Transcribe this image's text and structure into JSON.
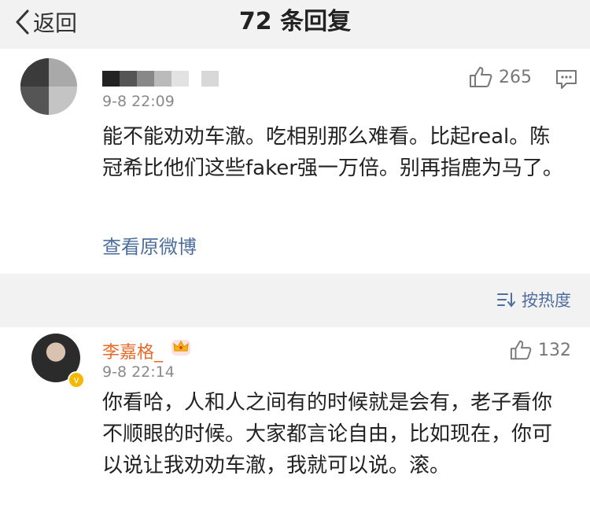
{
  "nav": {
    "back_label": "返回",
    "title": "72 条回复"
  },
  "main_comment": {
    "user": {
      "name": "",
      "avatar_icon": "blurred-avatar"
    },
    "time": "9-8 22:09",
    "likes": "265",
    "text": "能不能劝劝车澈。吃相别那么难看。比起real。陈冠希比他们这些faker强一万倍。别再指鹿为马了。",
    "link": "查看原微博"
  },
  "sort": {
    "label": "按热度"
  },
  "reply": {
    "user": {
      "name": "李嘉格_",
      "name_color": "#e86a2a",
      "badge_icon": "crown-icon",
      "verified_icon": "verified-icon"
    },
    "time": "9-8 22:14",
    "likes": "132",
    "text": "你看哈，人和人之间有的时候就是会有，老子看你不顺眼的时候。大家都言论自由，比如现在，你可以说让我劝劝车澈，我就可以说。滚。"
  },
  "colors": {
    "link": "#4e6e9e",
    "background": "#f2f2f2"
  }
}
